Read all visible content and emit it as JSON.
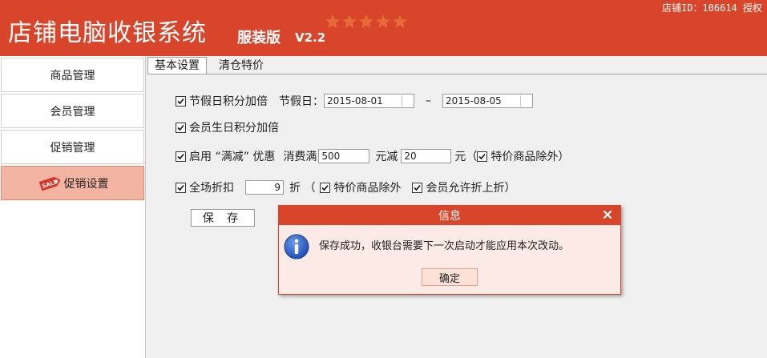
{
  "header": {
    "title": "店铺电脑收银系统",
    "edition": "服装版",
    "version": "V2.2",
    "store_info": "店铺ID：106614 授权"
  },
  "sidebar": {
    "items": [
      {
        "label": "商品管理",
        "active": false
      },
      {
        "label": "会员管理",
        "active": false
      },
      {
        "label": "促销管理",
        "active": false
      },
      {
        "label": "促销设置",
        "active": true,
        "icon": "sale-tag-icon"
      }
    ]
  },
  "tabs": [
    {
      "label": "基本设置",
      "active": true
    },
    {
      "label": "清仓特价",
      "active": false
    }
  ],
  "form": {
    "holiday": {
      "label": "节假日积分加倍",
      "checked": true,
      "date_label": "节假日：",
      "start": "2015-08-01",
      "dash": "–",
      "end": "2015-08-05"
    },
    "birthday": {
      "label": "会员生日积分加倍",
      "checked": true
    },
    "full_reduce": {
      "label": "启用 “满减” 优惠",
      "checked": true,
      "spend_label": "消费满",
      "spend_value": "500",
      "reduce_label": "元减",
      "reduce_value": "20",
      "unit_open": "元（",
      "exclude_label": "特价商品除外）",
      "exclude_checked": true
    },
    "discount": {
      "label": "全场折扣",
      "checked": true,
      "value": "9",
      "unit_open": "折 （",
      "exclude_label": "特价商品除外",
      "exclude_checked": true,
      "member_label": "会员允许折上折）",
      "member_checked": true
    },
    "save_label": "保 存"
  },
  "dialog": {
    "title": "信息",
    "message": "保存成功，收银台需要下一次启动才能应用本次改动。",
    "ok_label": "确定"
  },
  "colors": {
    "brand": "#d8452b",
    "active_sidebar": "#f4b4a2",
    "dialog_bg": "#fbeae5"
  }
}
